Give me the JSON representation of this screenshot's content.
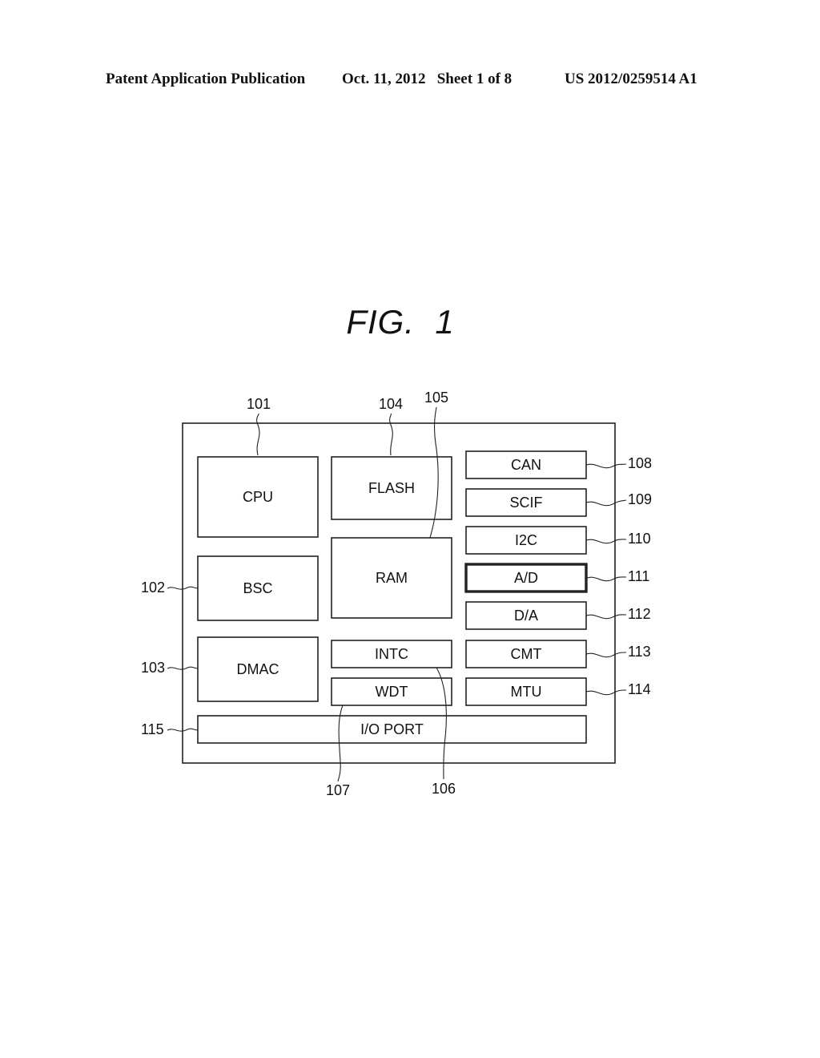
{
  "header": {
    "publication": "Patent Application Publication",
    "date_sheet": "Oct. 11, 2012   Sheet 1 of 8",
    "number": "US 2012/0259514 A1"
  },
  "figure": {
    "title": "FIG.  1",
    "container": {
      "ref": ""
    },
    "blocks": [
      {
        "id": "cpu",
        "label": "CPU",
        "ref": "101",
        "emphasis": false
      },
      {
        "id": "bsc",
        "label": "BSC",
        "ref": "102",
        "emphasis": false
      },
      {
        "id": "dmac",
        "label": "DMAC",
        "ref": "103",
        "emphasis": false
      },
      {
        "id": "flash",
        "label": "FLASH",
        "ref": "104",
        "emphasis": false
      },
      {
        "id": "ram",
        "label": "RAM",
        "ref": "105",
        "emphasis": false
      },
      {
        "id": "intc",
        "label": "INTC",
        "ref": "106",
        "emphasis": false
      },
      {
        "id": "wdt",
        "label": "WDT",
        "ref": "107",
        "emphasis": false
      },
      {
        "id": "can",
        "label": "CAN",
        "ref": "108",
        "emphasis": false
      },
      {
        "id": "scif",
        "label": "SCIF",
        "ref": "109",
        "emphasis": false
      },
      {
        "id": "i2c",
        "label": "I2C",
        "ref": "110",
        "emphasis": false
      },
      {
        "id": "ad",
        "label": "A/D",
        "ref": "111",
        "emphasis": true
      },
      {
        "id": "da",
        "label": "D/A",
        "ref": "112",
        "emphasis": false
      },
      {
        "id": "cmt",
        "label": "CMT",
        "ref": "113",
        "emphasis": false
      },
      {
        "id": "mtu",
        "label": "MTU",
        "ref": "114",
        "emphasis": false
      },
      {
        "id": "io",
        "label": "I/O PORT",
        "ref": "115",
        "emphasis": false
      }
    ]
  }
}
